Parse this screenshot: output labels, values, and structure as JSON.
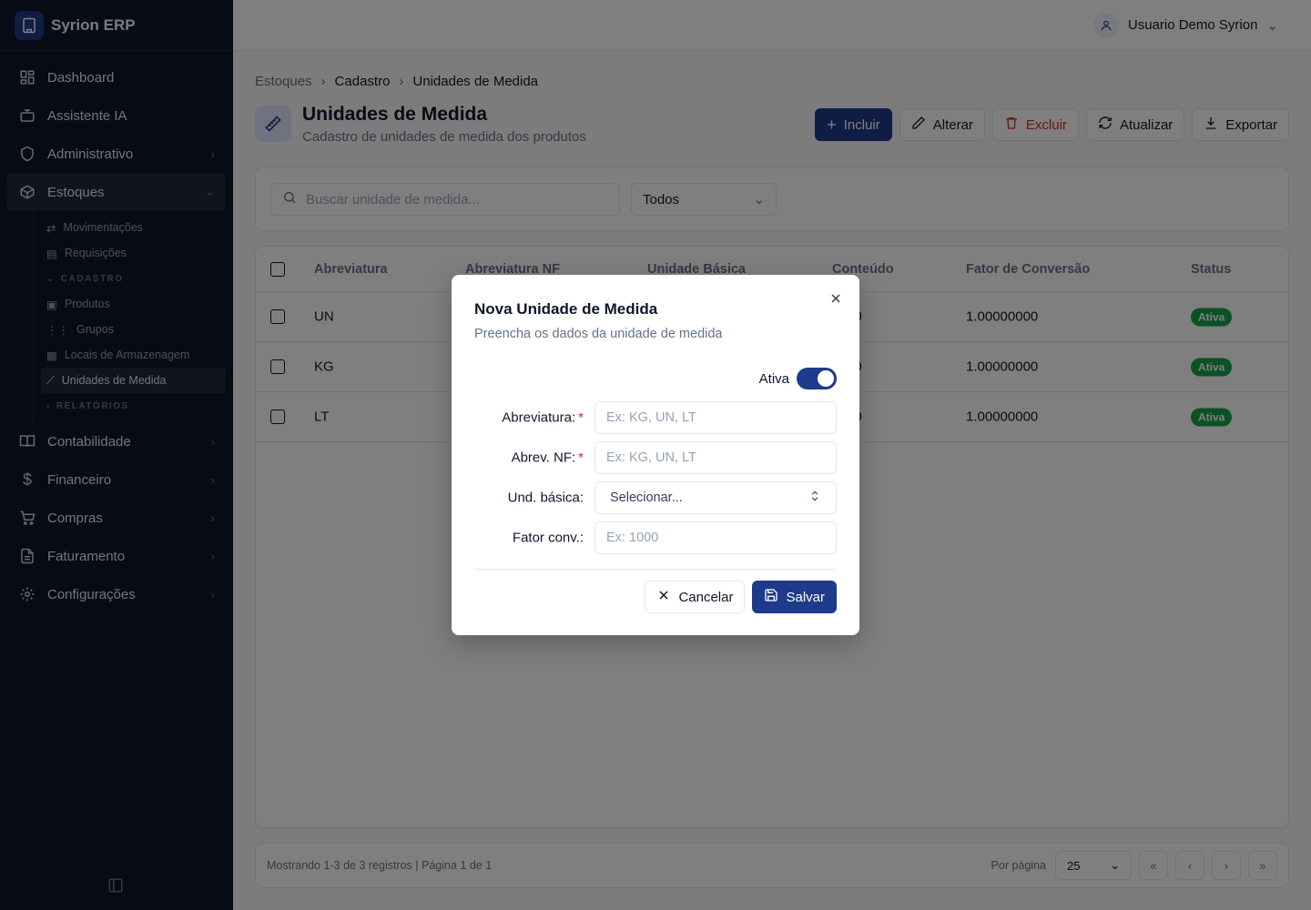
{
  "brand": {
    "name": "Syrion ERP"
  },
  "user": {
    "name": "Usuario Demo Syrion"
  },
  "sidebar": {
    "items": [
      {
        "label": "Dashboard"
      },
      {
        "label": "Assistente IA"
      },
      {
        "label": "Administrativo"
      },
      {
        "label": "Estoques"
      },
      {
        "label": "Contabilidade"
      },
      {
        "label": "Financeiro"
      },
      {
        "label": "Compras"
      },
      {
        "label": "Faturamento"
      },
      {
        "label": "Configurações"
      }
    ],
    "estoques_sub": {
      "items_top": [
        "Movimentações",
        "Requisições"
      ],
      "section_cadastro": "CADASTRO",
      "items_cadastro": [
        "Produtos",
        "Grupos",
        "Locais de Armazenagem",
        "Unidades de Medida"
      ],
      "section_relatorios": "RELATÓRIOS"
    }
  },
  "breadcrumb": [
    "Estoques",
    "Cadastro",
    "Unidades de Medida"
  ],
  "page": {
    "title": "Unidades de Medida",
    "subtitle": "Cadastro de unidades de medida dos produtos"
  },
  "toolbar": {
    "incluir": "Incluir",
    "alterar": "Alterar",
    "excluir": "Excluir",
    "atualizar": "Atualizar",
    "exportar": "Exportar"
  },
  "filters": {
    "search_placeholder": "Buscar unidade de medida...",
    "status_value": "Todos"
  },
  "table": {
    "headers": [
      "Abreviatura",
      "Abreviatura NF",
      "Unidade Básica",
      "Conteúdo",
      "Fator de Conversão",
      "Status"
    ],
    "rows": [
      {
        "abrev": "UN",
        "conteudo": "00",
        "fator": "1.00000000",
        "status": "Ativa"
      },
      {
        "abrev": "KG",
        "conteudo": "00",
        "fator": "1.00000000",
        "status": "Ativa"
      },
      {
        "abrev": "LT",
        "conteudo": "00",
        "fator": "1.00000000",
        "status": "Ativa"
      }
    ]
  },
  "footer": {
    "info": "Mostrando 1-3 de 3 registros | Página 1 de 1",
    "per_page_label": "Por página",
    "per_page_value": "25"
  },
  "modal": {
    "title": "Nova Unidade de Medida",
    "subtitle": "Preencha os dados da unidade de medida",
    "active_label": "Ativa",
    "fields": {
      "abrev_label": "Abreviatura:",
      "abrev_placeholder": "Ex: KG, UN, LT",
      "abrevnf_label": "Abrev. NF:",
      "abrevnf_placeholder": "Ex: KG, UN, LT",
      "und_label": "Und. básica:",
      "und_value": "Selecionar...",
      "fator_label": "Fator conv.:",
      "fator_placeholder": "Ex: 1000"
    },
    "required_mark": "*",
    "cancel": "Cancelar",
    "save": "Salvar"
  },
  "colors": {
    "primary": "#1e3a8a",
    "danger": "#dc2626",
    "success": "#16a34a",
    "sidebar_bg": "#0f172a"
  }
}
